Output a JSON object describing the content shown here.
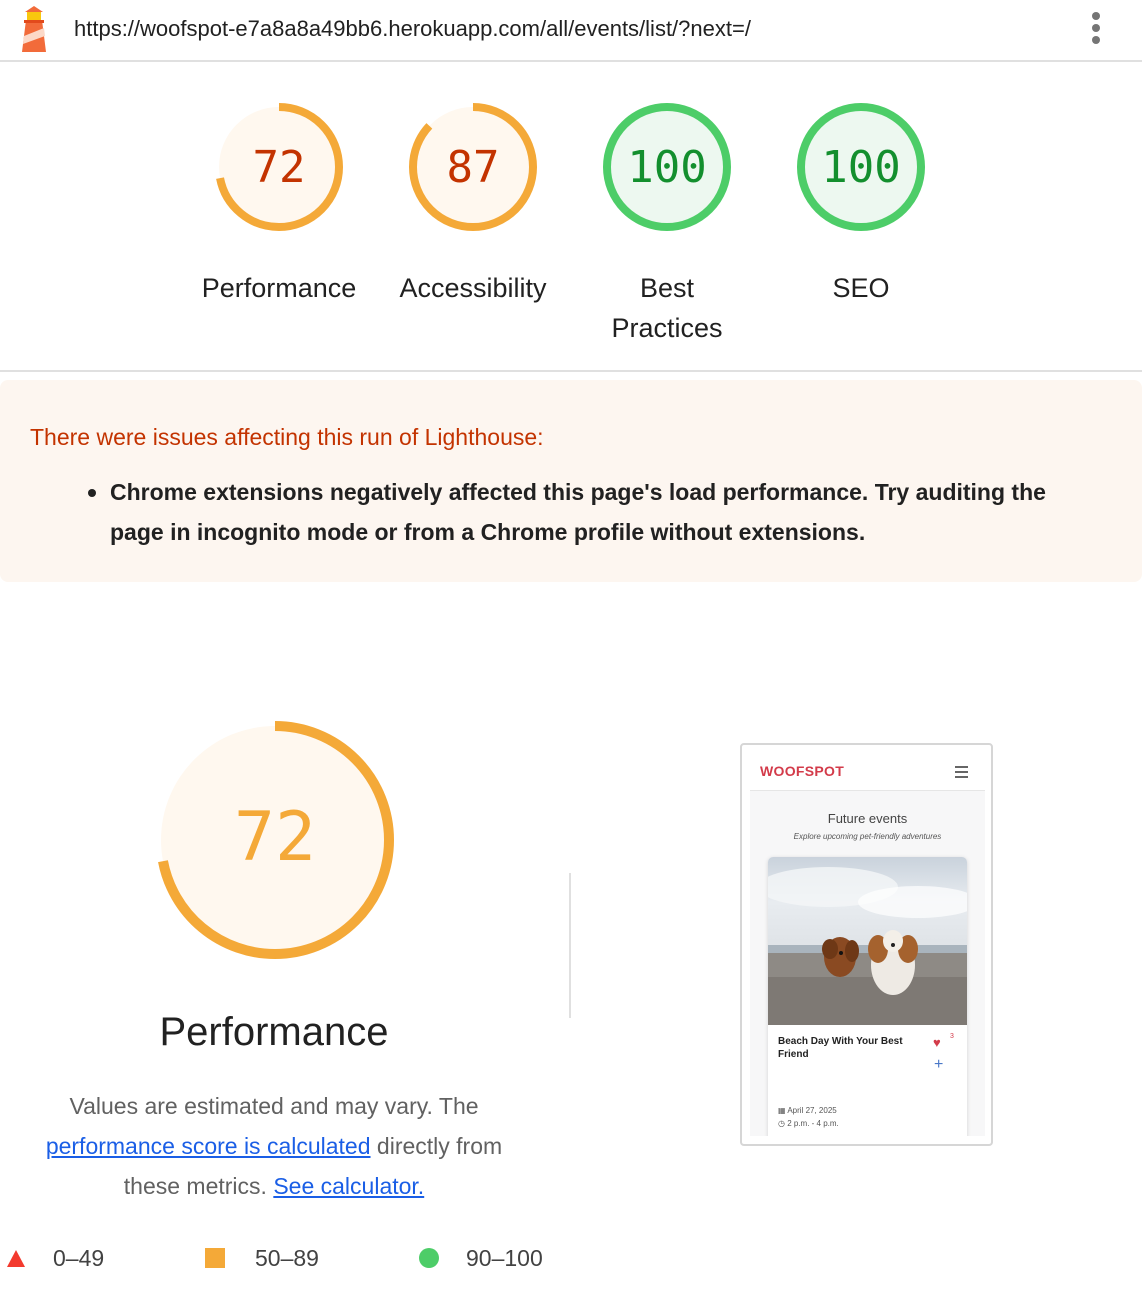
{
  "topbar": {
    "url": "https://woofspot-e7a8a8a49bb6.herokuapp.com/all/events/list/?next=/"
  },
  "gauges": [
    {
      "score": "72",
      "label": "Performance",
      "value": 0.72,
      "color": "#f4a938",
      "text_color": "#c33300",
      "fill": "#fff8ef"
    },
    {
      "score": "87",
      "label": "Accessibility",
      "value": 0.87,
      "color": "#f4a938",
      "text_color": "#c33300",
      "fill": "#fff8ef"
    },
    {
      "score": "100",
      "label": "Best Practices",
      "value": 1.0,
      "color": "#4dcd68",
      "text_color": "#138f2e",
      "fill": "#edf8f0"
    },
    {
      "score": "100",
      "label": "SEO",
      "value": 1.0,
      "color": "#4dcd68",
      "text_color": "#138f2e",
      "fill": "#edf8f0"
    }
  ],
  "warning": {
    "heading": "There were issues affecting this run of Lighthouse:",
    "items": [
      "Chrome extensions negatively affected this page's load performance. Try auditing the page in incognito mode or from a Chrome profile without extensions."
    ]
  },
  "performance": {
    "score": "72",
    "value": 0.72,
    "color": "#f4a938",
    "title": "Performance",
    "desc_start": "Values are estimated and may vary. The ",
    "desc_link1": "performance score is calculated",
    "desc_mid": " directly from these metrics. ",
    "desc_link2": "See calculator."
  },
  "thumbnail": {
    "brand": "WOOFSPOT",
    "page_title": "Future events",
    "page_subtitle": "Explore upcoming pet-friendly adventures",
    "card_title": "Beach Day With Your Best Friend",
    "likes": "3",
    "date": "April 27, 2025",
    "time": "2 p.m. - 4 p.m."
  },
  "legend": [
    {
      "range": "0–49",
      "shape": "triangle",
      "color": "#f33a2e"
    },
    {
      "range": "50–89",
      "shape": "square",
      "color": "#f4a938"
    },
    {
      "range": "90–100",
      "shape": "circle",
      "color": "#4dcd68"
    }
  ]
}
